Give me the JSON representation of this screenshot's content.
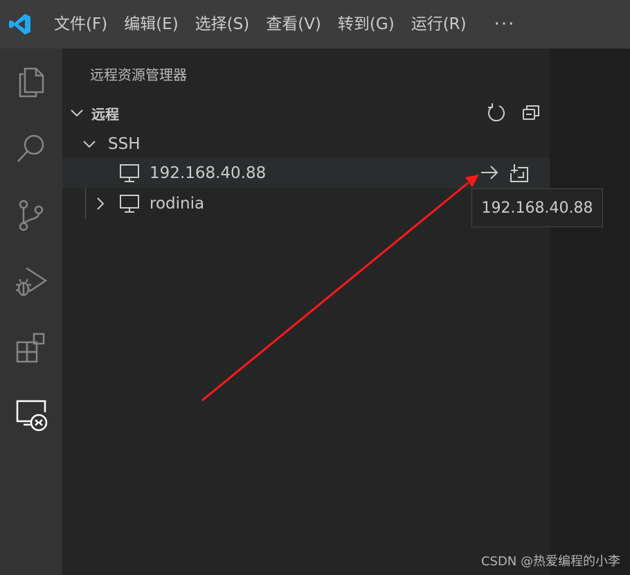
{
  "menubar": {
    "items": [
      "文件(F)",
      "编辑(E)",
      "选择(S)",
      "查看(V)",
      "转到(G)",
      "运行(R)"
    ],
    "more": "···"
  },
  "sidebar": {
    "title": "远程资源管理器",
    "section": "远程",
    "group": "SSH",
    "hosts": [
      {
        "label": "192.168.40.88",
        "expanded": false,
        "selected": true
      },
      {
        "label": "rodinia",
        "expanded": false,
        "selected": false
      }
    ]
  },
  "tooltip": {
    "text": "192.168.40.88"
  },
  "watermark": "CSDN @热爱编程的小李",
  "colors": {
    "accent_vscode_blue": "#23a9f2",
    "annotation_arrow": "#ff1a1a",
    "titlebar": "#3c3c3c",
    "activitybar": "#333333",
    "sidebar": "#252526"
  },
  "icons": {
    "activitybar": [
      "files-icon",
      "search-icon",
      "source-control-icon",
      "run-debug-icon",
      "extensions-icon",
      "remote-explorer-icon"
    ],
    "section_actions": [
      "refresh-icon",
      "collapse-all-icon"
    ],
    "row_actions": [
      "connect-current-window-icon",
      "connect-new-window-icon"
    ]
  }
}
